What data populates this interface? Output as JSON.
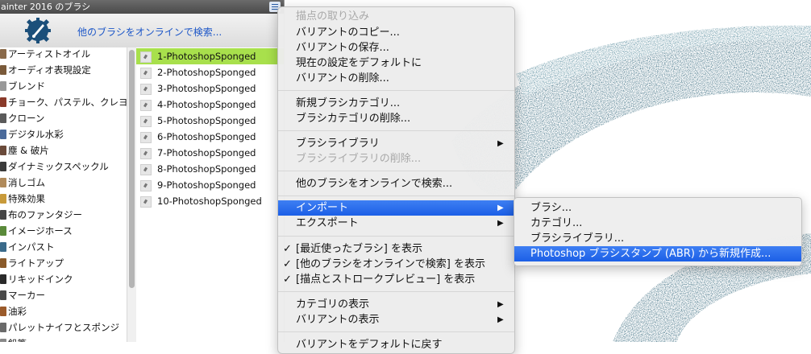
{
  "panel": {
    "title": "ainter 2016 のブラシ",
    "online_search": "他のブラシをオンラインで検索..."
  },
  "categories": [
    {
      "label": "アーティストオイル",
      "color": "#8a6a4a"
    },
    {
      "label": "オーディオ表現設定",
      "color": "#7a5a3a"
    },
    {
      "label": "ブレンド",
      "color": "#999999"
    },
    {
      "label": "チョーク、パステル、クレヨ",
      "color": "#8a3a2a"
    },
    {
      "label": "クローン",
      "color": "#5a5a5a"
    },
    {
      "label": "デジタル水彩",
      "color": "#4a6a9a"
    },
    {
      "label": "塵 & 破片",
      "color": "#6a4a3a"
    },
    {
      "label": "ダイナミックスペックル",
      "color": "#3a3a3a"
    },
    {
      "label": "消しゴム",
      "color": "#b08a5a"
    },
    {
      "label": "特殊効果",
      "color": "#c89a3a"
    },
    {
      "label": "布のファンタジー",
      "color": "#444444"
    },
    {
      "label": "イメージホース",
      "color": "#5a8a3a"
    },
    {
      "label": "インパスト",
      "color": "#3a6a8a"
    },
    {
      "label": "ライトアップ",
      "color": "#8a5a2a"
    },
    {
      "label": "リキッドインク",
      "color": "#2a2a2a"
    },
    {
      "label": "マーカー",
      "color": "#4a4a4a"
    },
    {
      "label": "油彩",
      "color": "#9a5a2a"
    },
    {
      "label": "パレットナイフとスポンジ",
      "color": "#6a6a6a"
    },
    {
      "label": "鉛筆",
      "color": "#888888"
    }
  ],
  "variants": [
    "1-PhotoshopSponged",
    "2-PhotoshopSponged",
    "3-PhotoshopSponged",
    "4-PhotoshopSponged",
    "5-PhotoshopSponged",
    "6-PhotoshopSponged",
    "7-PhotoshopSponged",
    "8-PhotoshopSponged",
    "9-PhotoshopSponged",
    "10-PhotoshopSponged"
  ],
  "menu": {
    "capture_dab": "描点の取り込み",
    "copy_variant": "バリアントのコピー...",
    "save_variant": "バリアントの保存...",
    "set_default": "現在の設定をデフォルトに",
    "delete_variant": "バリアントの削除...",
    "new_category": "新規ブラシカテゴリ...",
    "delete_category": "ブラシカテゴリの削除...",
    "brush_library": "ブラシライブラリ",
    "delete_library": "ブラシライブラリの削除...",
    "online_search": "他のブラシをオンラインで検索...",
    "import": "インポート",
    "export": "エクスポート",
    "show_recent": "[最近使ったブラシ] を表示",
    "show_online": "[他のブラシをオンラインで検索] を表示",
    "show_preview": "[描点とストロークプレビュー] を表示",
    "show_category": "カテゴリの表示",
    "show_variant": "バリアントの表示",
    "reset_variant": "バリアントをデフォルトに戻す"
  },
  "submenu": {
    "brush": "ブラシ...",
    "category": "カテゴリ...",
    "library": "ブラシライブラリ...",
    "abr": "Photoshop ブラシスタンプ (ABR) から新規作成..."
  },
  "glyphs": {
    "arrow": "▶",
    "check": "✓"
  },
  "colors": {
    "stroke": "#2f6378",
    "selection": "#a8e04c",
    "menu_highlight": "#2a6cf0"
  }
}
